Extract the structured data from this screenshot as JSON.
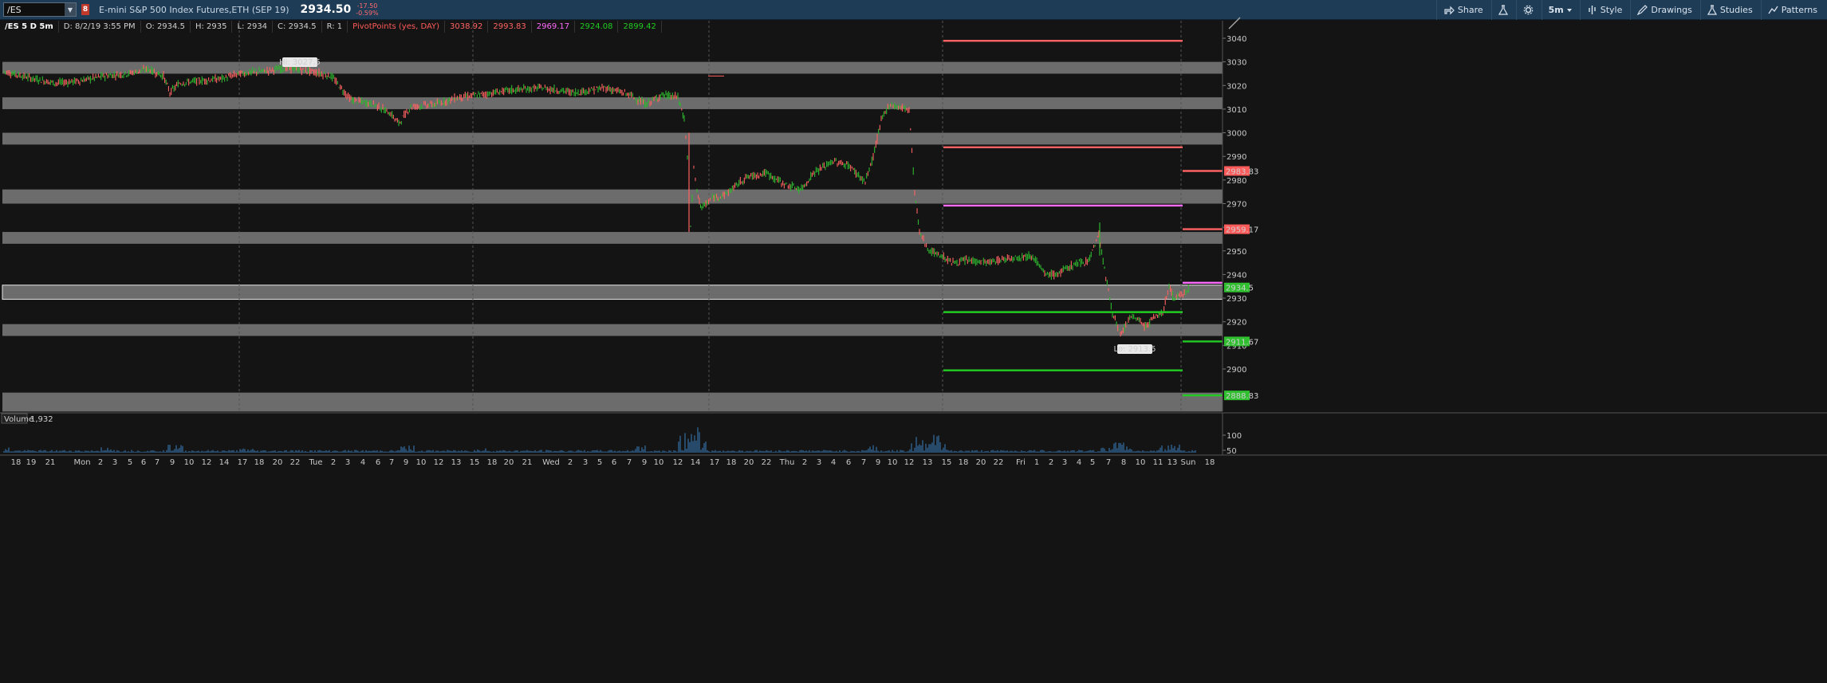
{
  "toolbar": {
    "symbol": "/ES",
    "link_badge": "8",
    "instrument_title": "E-mini S&P 500 Index Futures,ETH (SEP 19)",
    "last_price": "2934.50",
    "net_change": "-17.50",
    "net_change_pct": "-0.59%",
    "share_label": "Share",
    "timeframe_label": "5m",
    "style_label": "Style",
    "drawings_label": "Drawings",
    "studies_label": "Studies",
    "patterns_label": "Patterns"
  },
  "infobar": {
    "chart_desc": "/ES 5 D 5m",
    "bar_time": "D: 8/2/19 3:55 PM",
    "open": "O: 2934.5",
    "high": "H: 2935",
    "low": "L: 2934",
    "close": "C: 2934.5",
    "range": "R: 1",
    "study_name": "PivotPoints (yes, DAY)",
    "pivot_r2": "3038.92",
    "pivot_r1": "2993.83",
    "pivot_pp": "2969.17",
    "pivot_s1": "2924.08",
    "pivot_s2": "2899.42"
  },
  "colors": {
    "up": "#2eb82e",
    "down": "#ff6262",
    "resistance": "#ff6262",
    "pivot": "#ff6bff",
    "support": "#22cc22",
    "zone": "#808080",
    "volume": "#3a7fbf"
  },
  "annotations": {
    "hi_label": "Hi: 3027.5",
    "lo_label": "Lo: 2913.5"
  },
  "y_axis": {
    "ticks": [
      "3040",
      "3030",
      "3020",
      "3010",
      "3000",
      "2990",
      "2980",
      "2970",
      "2960",
      "2950",
      "2940",
      "2930",
      "2920",
      "2910",
      "2900"
    ],
    "price_tags": [
      {
        "value": "2983.83",
        "color": "#ff5a5a"
      },
      {
        "value": "2959.17",
        "color": "#ff5a5a"
      },
      {
        "value": "2934.5",
        "color": "#2fbf2f"
      },
      {
        "value": "2911.67",
        "color": "#2fbf2f"
      },
      {
        "value": "2888.83",
        "color": "#2fbf2f"
      }
    ]
  },
  "volume_panel": {
    "label": "Volume",
    "value": "1,932",
    "ticks": [
      "100",
      "50"
    ]
  },
  "x_axis": {
    "labels": [
      "18",
      "19",
      "21",
      "Mon",
      "2",
      "3",
      "5",
      "6",
      "7",
      "9",
      "10",
      "12",
      "14",
      "17",
      "18",
      "20",
      "22",
      "Tue",
      "2",
      "3",
      "4",
      "6",
      "7",
      "9",
      "10",
      "12",
      "13",
      "15",
      "18",
      "20",
      "21",
      "Wed",
      "2",
      "3",
      "5",
      "6",
      "7",
      "9",
      "10",
      "12",
      "14",
      "17",
      "18",
      "20",
      "22",
      "Thu",
      "2",
      "3",
      "4",
      "6",
      "7",
      "9",
      "10",
      "12",
      "13",
      "15",
      "18",
      "20",
      "22",
      "Fri",
      "1",
      "2",
      "3",
      "4",
      "5",
      "7",
      "8",
      "10",
      "11",
      "13",
      "Sun",
      "18"
    ]
  }
}
